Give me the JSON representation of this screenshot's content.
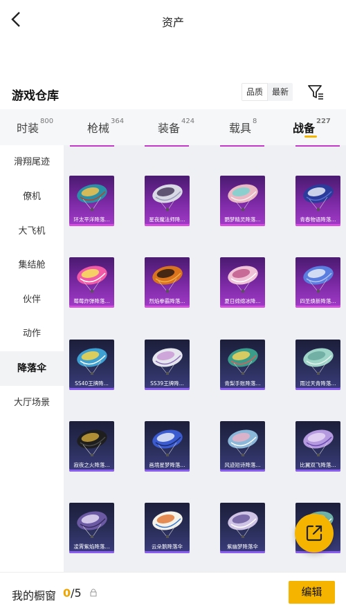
{
  "header": {
    "title": "资产",
    "back_icon": "chevron-left-icon"
  },
  "section": {
    "title": "游戏仓库",
    "sort_options": [
      "品质",
      "最新"
    ],
    "active_sort": "品质",
    "filter_icon": "filter-icon"
  },
  "tabs": [
    {
      "label": "时装",
      "count": "800"
    },
    {
      "label": "枪械",
      "count": "364"
    },
    {
      "label": "装备",
      "count": "424"
    },
    {
      "label": "载具",
      "count": "8"
    },
    {
      "label": "战备",
      "count": "227"
    }
  ],
  "active_tab": "战备",
  "sidebar": [
    "滑翔尾迹",
    "僚机",
    "大飞机",
    "集结舱",
    "伙伴",
    "动作",
    "降落伞",
    "大厅场景"
  ],
  "active_sidebar": "降落伞",
  "items": [
    {
      "name": "环太平洋降落...",
      "tier": "purple"
    },
    {
      "name": "星夜魔法师降...",
      "tier": "purple"
    },
    {
      "name": "鹦梦精灵降落...",
      "tier": "purple"
    },
    {
      "name": "青春物语降落...",
      "tier": "purple"
    },
    {
      "name": "莓莓炸弹降落...",
      "tier": "purple"
    },
    {
      "name": "烈焰拳霸降落...",
      "tier": "purple"
    },
    {
      "name": "夏日绵绵冰降...",
      "tier": "purple"
    },
    {
      "name": "四圣焕新降落...",
      "tier": "purple"
    },
    {
      "name": "SS40王牌降...",
      "tier": "blue"
    },
    {
      "name": "SS39王牌降...",
      "tier": "blue"
    },
    {
      "name": "青梨手账降落...",
      "tier": "blue"
    },
    {
      "name": "雨过天青降落...",
      "tier": "blue"
    },
    {
      "name": "寂夜之火降落...",
      "tier": "blue"
    },
    {
      "name": "画境星梦降落...",
      "tier": "blue"
    },
    {
      "name": "风迹短诗降落...",
      "tier": "blue"
    },
    {
      "name": "比翼双飞降落...",
      "tier": "blue"
    },
    {
      "name": "凌霄紫焰降落...",
      "tier": "blue"
    },
    {
      "name": "云朵鹅降落伞",
      "tier": "blue"
    },
    {
      "name": "紫幽梦降落伞",
      "tier": "blue"
    },
    {
      "name": "...",
      "tier": "blue"
    }
  ],
  "fab": {
    "icon": "share-external-icon"
  },
  "showcase": {
    "label": "我的橱窗",
    "current": "0",
    "total": "/5",
    "lock_icon": "lock-icon"
  },
  "edit_label": "编辑",
  "colors": {
    "accent": "#f5b400",
    "purple_tier": "#a23bc8",
    "blue_tier": "#3a3c7c"
  }
}
